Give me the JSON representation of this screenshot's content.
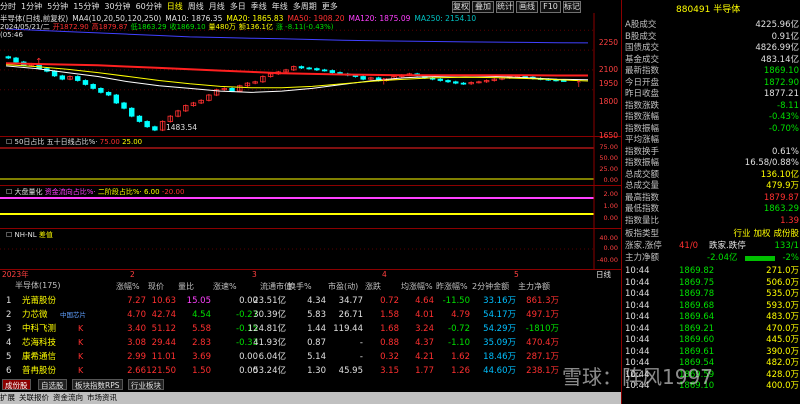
{
  "toolbar": {
    "items": [
      "分时",
      "1分钟",
      "5分钟",
      "15分钟",
      "30分钟",
      "60分钟",
      "日线",
      "周线",
      "月线",
      "多日",
      "季线",
      "年线",
      "多周期",
      "更多"
    ],
    "active": "日线",
    "right_buttons": [
      "复权",
      "叠加",
      "统计",
      "画线",
      "F10",
      "标记"
    ]
  },
  "chart_header": {
    "line1": [
      "半导体(日线,前复权)",
      "MA4(10,20,50,120,250)",
      "MA10: 1876.35",
      "MA20: 1865.83",
      "MA50: 1908.20",
      "MA120: 1875.09",
      "MA250: 2154.10"
    ],
    "line2": [
      "2024/05/21/二",
      "开1872.90",
      "高1879.87",
      "低1863.29",
      "收1869.10",
      "量480万",
      "额136.1亿",
      "涨 -8.11(-0.43%)"
    ],
    "line3": [
      "(05:46"
    ]
  },
  "main_yaxis": [
    "2250",
    "2100",
    "1950",
    "1800",
    "1650"
  ],
  "annotation_low": "1483.54",
  "panel2": {
    "title": "50日占比",
    "name": "五十日线占比%·",
    "v1": "75.00",
    "v2": "25.00",
    "yaxis": [
      "75.00",
      "50.00",
      "25.00",
      "0.00"
    ]
  },
  "panel3": {
    "title": "大盘量化",
    "a": "资金流向占比%·",
    "b": "二阶段占比%·",
    "v1": "6.00",
    "v2": "-20.00",
    "yaxis": [
      "2.00",
      "1.00",
      "0.00"
    ]
  },
  "panel4": {
    "title": "NH-NL",
    "v": "差值",
    "yaxis": [
      "40.00",
      "0.00",
      "-40.00"
    ]
  },
  "time_axis": {
    "labels": [
      "2023年",
      "2",
      "3",
      "4",
      "5"
    ],
    "period": "日线"
  },
  "table": {
    "title": "半导体(175)",
    "headers": [
      "涨幅%",
      "现价",
      "量比",
      "涨速%",
      "流通市值",
      "换手%",
      "市盈(动)",
      "涨跌",
      "均涨幅%",
      "昨涨幅%",
      "2分钟金额",
      "主力净额"
    ],
    "rows": [
      {
        "n": "1",
        "name": "光莆股份",
        "flag": "",
        "c": [
          "7.27",
          "10.63",
          "15.05",
          "0.00",
          "23.51亿",
          "4.34",
          "34.77",
          "0.72",
          "4.64",
          "-11.50",
          "33.16万",
          "861.3万"
        ]
      },
      {
        "n": "2",
        "name": "力芯微",
        "flag": "中国芯片",
        "c": [
          "4.70",
          "42.74",
          "4.54",
          "-0.27",
          "30.39亿",
          "5.83",
          "26.71",
          "1.58",
          "4.01",
          "4.79",
          "54.17万",
          "497.1万"
        ]
      },
      {
        "n": "3",
        "name": "中科飞测",
        "flag": "K",
        "c": [
          "3.40",
          "51.12",
          "5.58",
          "-0.15",
          "124.81亿",
          "1.44",
          "119.44",
          "1.68",
          "3.24",
          "-0.72",
          "54.29万",
          "-1810万"
        ]
      },
      {
        "n": "4",
        "name": "芯海科技",
        "flag": "K",
        "c": [
          "3.08",
          "29.44",
          "2.83",
          "-0.33",
          "41.93亿",
          "0.87",
          "-",
          "0.88",
          "4.37",
          "-1.10",
          "35.09万",
          "470.4万"
        ]
      },
      {
        "n": "5",
        "name": "康希通信",
        "flag": "K",
        "c": [
          "2.99",
          "11.01",
          "3.69",
          "0.00",
          "6.04亿",
          "5.14",
          "-",
          "0.32",
          "4.21",
          "1.62",
          "18.46万",
          "287.1万"
        ]
      },
      {
        "n": "6",
        "name": "普冉股份",
        "flag": "K",
        "c": [
          "2.66",
          "121.50",
          "1.50",
          "0.00",
          "53.24亿",
          "1.30",
          "45.95",
          "3.15",
          "1.77",
          "1.26",
          "44.60万",
          "238.1万"
        ]
      }
    ]
  },
  "bottom_tabs": [
    "成份股",
    "自选股",
    "板块指数RPS",
    "行业板块"
  ],
  "status": [
    "扩展",
    "关联报价",
    "资金流向",
    "市场资讯"
  ],
  "right_panel": {
    "code": "880491",
    "name": "半导体",
    "rows": [
      {
        "k": "A股成交",
        "v": "4225.96亿",
        "cls": "wht"
      },
      {
        "k": "B股成交",
        "v": "0.91亿",
        "cls": "wht"
      },
      {
        "k": "国债成交",
        "v": "4826.99亿",
        "cls": "wht"
      },
      {
        "k": "基金成交",
        "v": "483.14亿",
        "cls": "wht"
      },
      {
        "k": "最新指数",
        "v": "1869.10",
        "cls": "grn"
      },
      {
        "k": "今日开盘",
        "v": "1872.90",
        "cls": "grn"
      },
      {
        "k": "昨日收盘",
        "v": "1877.21",
        "cls": "wht"
      },
      {
        "k": "指数涨跌",
        "v": "-8.11",
        "cls": "grn"
      },
      {
        "k": "指数涨幅",
        "v": "-0.43%",
        "cls": "grn"
      },
      {
        "k": "指数振幅",
        "v": "-0.70%",
        "cls": "grn"
      },
      {
        "k": "平均涨幅",
        "v": "",
        "cls": "wht"
      },
      {
        "k": "指数换手",
        "v": "0.61%",
        "cls": "wht"
      },
      {
        "k": "指数振幅",
        "v": "16.58/0.88%",
        "cls": "wht"
      },
      {
        "k": "总成交额",
        "v": "136.10亿",
        "cls": "yel"
      },
      {
        "k": "总成交量",
        "v": "479.9万",
        "cls": "yel"
      },
      {
        "k": "最高指数",
        "v": "1879.87",
        "cls": "red"
      },
      {
        "k": "最低指数",
        "v": "1863.29",
        "cls": "grn"
      },
      {
        "k": "指数量比",
        "v": "1.39",
        "cls": "red"
      }
    ],
    "type_row": {
      "k": "板指类型",
      "a": "行业",
      "b": "加权",
      "c": "成份股"
    },
    "updown": {
      "a": "涨家.涨停",
      "av": "41/0",
      "b": "跌家.跌停",
      "bv": "133/1"
    },
    "mainflow": {
      "k": "主力净额",
      "v": "-2.04亿",
      "pct": "-2%"
    },
    "ticks": [
      [
        "10:44",
        "1869.82",
        "271.0万"
      ],
      [
        "10:44",
        "1869.75",
        "506.0万"
      ],
      [
        "10:44",
        "1869.78",
        "535.0万"
      ],
      [
        "10:44",
        "1869.68",
        "593.0万"
      ],
      [
        "10:44",
        "1869.64",
        "483.0万"
      ],
      [
        "10:44",
        "1869.21",
        "470.0万"
      ],
      [
        "10:44",
        "1869.60",
        "445.0万"
      ],
      [
        "10:44",
        "1869.61",
        "390.0万"
      ],
      [
        "10:44",
        "1869.54",
        "482.0万"
      ],
      [
        "10:44",
        "1869.59",
        "428.0万"
      ],
      [
        "10:44",
        "1869.10",
        "400.0万"
      ]
    ]
  },
  "watermark": "雪球：阵风1997",
  "chart_data": {
    "type": "line",
    "title": "半导体(日线,前复权)",
    "series": [
      {
        "name": "MA10",
        "values": [
          1980,
          1960,
          1930,
          1900,
          1860,
          1830,
          1810,
          1790,
          1780,
          1790,
          1810,
          1840,
          1870,
          1890,
          1900,
          1905,
          1900,
          1890,
          1880,
          1876
        ]
      },
      {
        "name": "MA20",
        "values": [
          1990,
          1975,
          1955,
          1930,
          1900,
          1870,
          1845,
          1825,
          1815,
          1815,
          1825,
          1845,
          1865,
          1880,
          1890,
          1895,
          1892,
          1885,
          1875,
          1866
        ]
      },
      {
        "name": "MA50",
        "values": [
          2000,
          1995,
          1990,
          1985,
          1975,
          1965,
          1955,
          1945,
          1935,
          1925,
          1920,
          1915,
          1912,
          1910,
          1909,
          1909,
          1909,
          1909,
          1908,
          1908
        ]
      },
      {
        "name": "MA250",
        "values": [
          2260,
          2250,
          2240,
          2230,
          2220,
          2210,
          2200,
          2195,
          2190,
          2185,
          2180,
          2175,
          2170,
          2168,
          2165,
          2162,
          2160,
          2158,
          2156,
          2154
        ]
      }
    ],
    "ylim": [
      1450,
      2320
    ]
  }
}
